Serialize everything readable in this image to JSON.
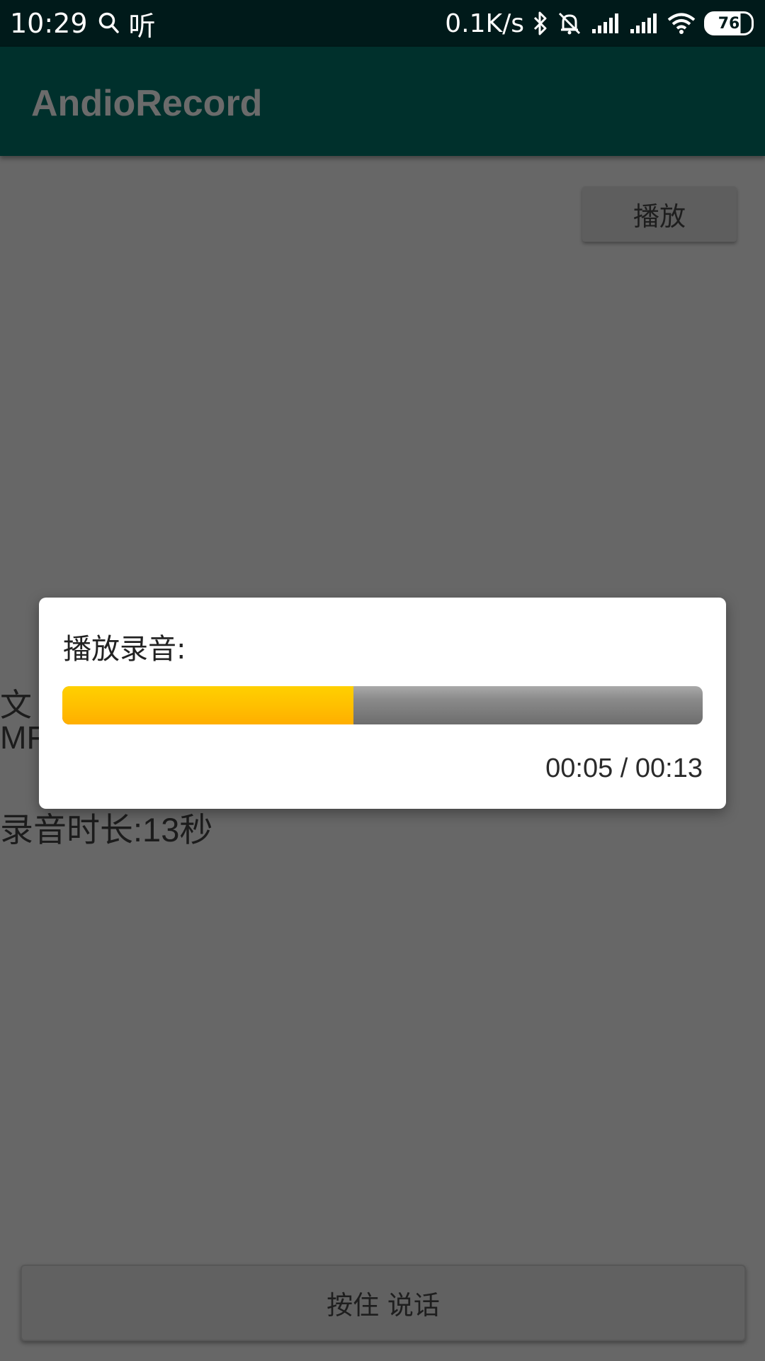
{
  "status_bar": {
    "time": "10:29",
    "listen_glyph": "听",
    "net_speed": "0.1K/s",
    "battery_level": "76",
    "icons": [
      "search-icon",
      "bluetooth-icon",
      "mute-bell-icon",
      "signal-icon",
      "signal-icon",
      "wifi-icon",
      "battery-icon"
    ]
  },
  "app_bar": {
    "title": "AndioRecord"
  },
  "main": {
    "play_button_label": "播放",
    "file_info_line1": "文",
    "file_info_line2": "MF",
    "duration_text": "录音时长:13秒",
    "talk_button_label": "按住 说话"
  },
  "dialog": {
    "title": "播放录音:",
    "progress_fraction": 0.4545,
    "time_display": "00:05 / 00:13",
    "colors": {
      "progress_fill": "#ffc000",
      "progress_track": "#8a8a8a"
    }
  },
  "colors": {
    "status_bar_bg": "#001a1a",
    "app_bar_bg": "#00302c",
    "scrim_bg": "#676767"
  }
}
